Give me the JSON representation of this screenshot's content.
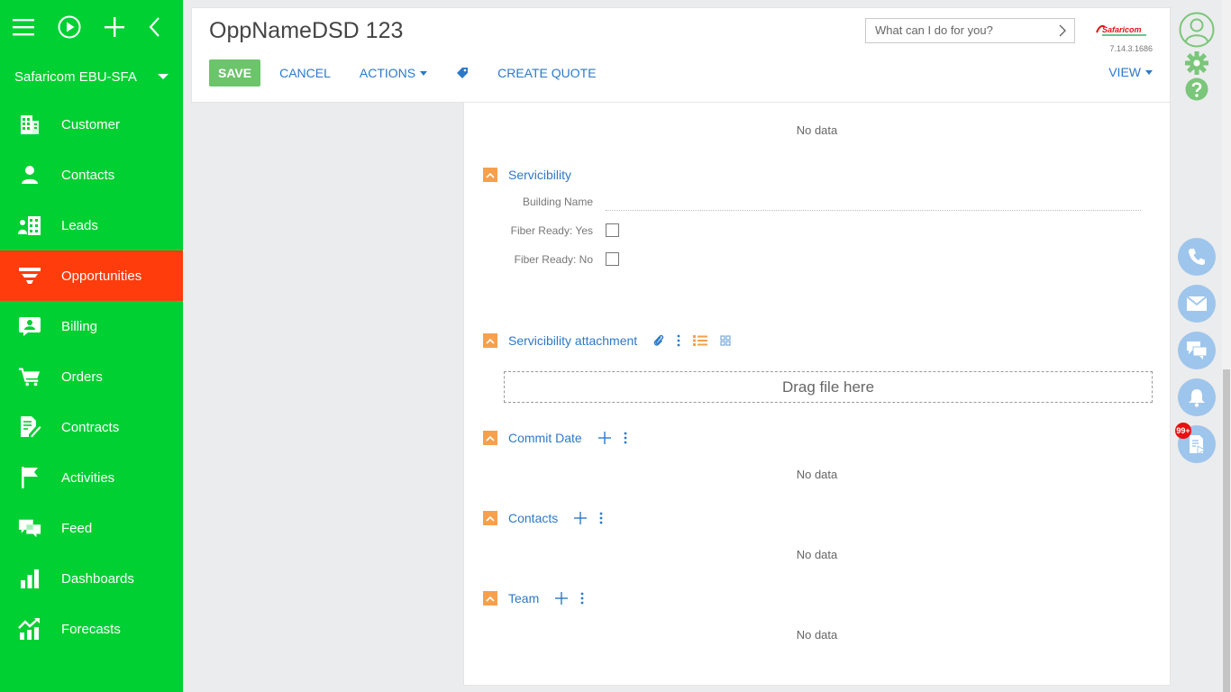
{
  "workspace": "Safaricom EBU-SFA",
  "sidebar": {
    "items": [
      {
        "label": "Customer",
        "icon": "building-icon"
      },
      {
        "label": "Contacts",
        "icon": "person-icon"
      },
      {
        "label": "Leads",
        "icon": "buildings-icon"
      },
      {
        "label": "Opportunities",
        "icon": "funnel-icon",
        "active": true
      },
      {
        "label": "Billing",
        "icon": "billing-icon"
      },
      {
        "label": "Orders",
        "icon": "cart-icon"
      },
      {
        "label": "Contracts",
        "icon": "contract-icon"
      },
      {
        "label": "Activities",
        "icon": "flag-icon"
      },
      {
        "label": "Feed",
        "icon": "chat-icon"
      },
      {
        "label": "Dashboards",
        "icon": "bar-chart-icon"
      },
      {
        "label": "Forecasts",
        "icon": "trend-icon"
      }
    ]
  },
  "header": {
    "title": "OppNameDSD 123",
    "save_label": "SAVE",
    "cancel_label": "CANCEL",
    "actions_label": "ACTIONS",
    "create_quote_label": "CREATE QUOTE",
    "view_label": "VIEW",
    "search_placeholder": "What can I do for you?",
    "logo_text": "Safaricom",
    "version": "7.14.3.1686"
  },
  "content": {
    "top_nodata": "No data",
    "servicibility": {
      "title": "Servicibility",
      "building_name_label": "Building Name",
      "fiber_yes_label": "Fiber Ready: Yes",
      "fiber_no_label": "Fiber Ready: No"
    },
    "attachment": {
      "title": "Servicibility attachment",
      "dropzone": "Drag file here"
    },
    "commit_date": {
      "title": "Commit Date",
      "nodata": "No data"
    },
    "contacts": {
      "title": "Contacts",
      "nodata": "No data"
    },
    "team": {
      "title": "Team",
      "nodata": "No data"
    }
  },
  "notifications_badge": "99+",
  "colors": {
    "sidebar_bg": "#00d032",
    "active_item": "#ff3c0c",
    "link": "#2c79c9",
    "save_button": "#6cc46b",
    "group_chevron": "#f6a04d"
  }
}
